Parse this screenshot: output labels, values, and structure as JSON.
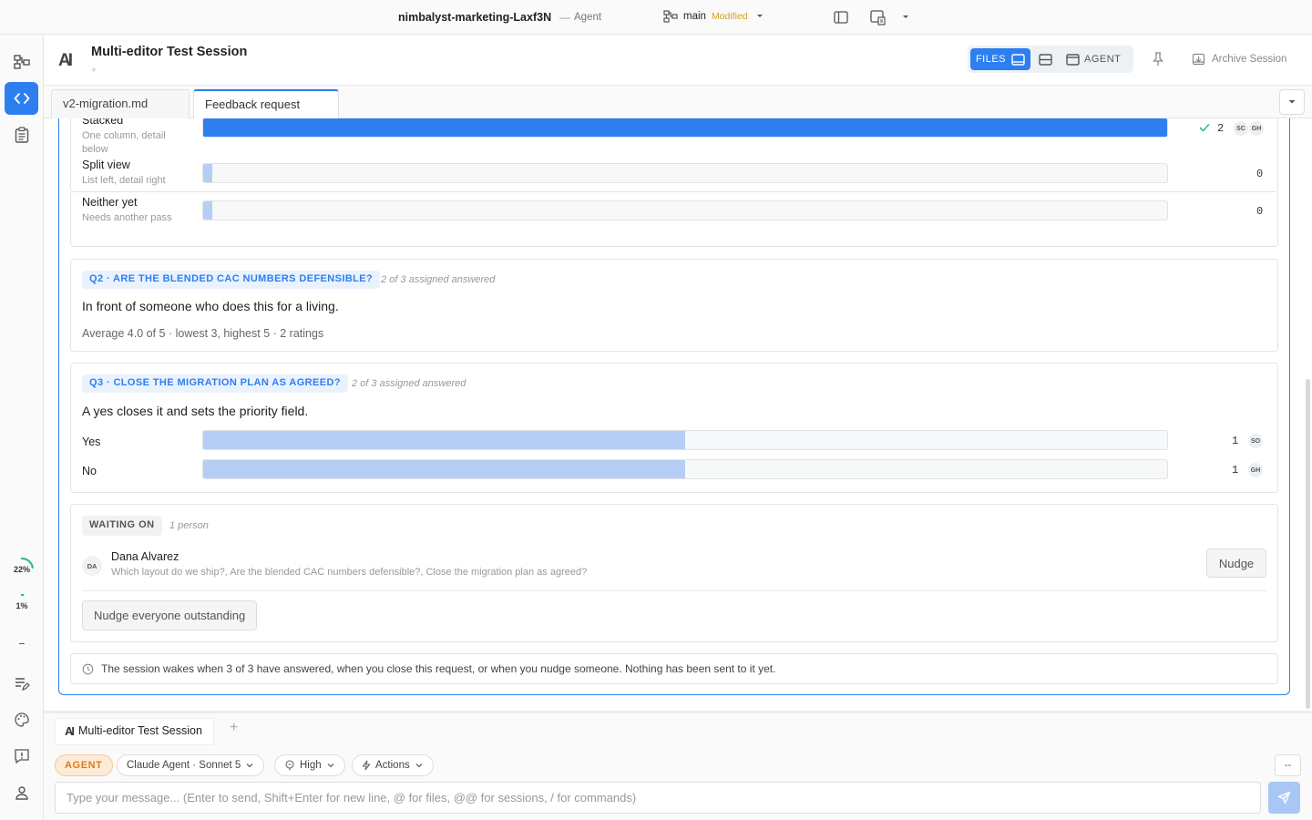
{
  "titlebar": {
    "project": "nimbalyst-marketing-Laxf3N",
    "separator": "—",
    "mode": "Agent",
    "branch": "main",
    "branch_status": "Modified"
  },
  "sidebar": {
    "usage": [
      {
        "label": "22%",
        "value": 0.22
      },
      {
        "label": "1%",
        "value": 0.01
      },
      {
        "label": "--",
        "value": 0
      }
    ]
  },
  "header": {
    "logo": "AI",
    "title": "Multi-editor Test Session",
    "add": "+",
    "files_label": "FILES",
    "agent_label": "AGENT",
    "archive_label": "Archive Session"
  },
  "tabs": [
    {
      "label": "v2-migration.md",
      "active": false
    },
    {
      "label": "Feedback request",
      "active": true
    }
  ],
  "q1": {
    "options": [
      {
        "label": "Stacked",
        "sub": "One column, detail below",
        "fraction": 1.0,
        "count": "2",
        "chips": [
          "SC",
          "GH"
        ]
      },
      {
        "label": "Split view",
        "sub": "List left, detail right",
        "fraction": 0.0,
        "count": "0",
        "chips": []
      },
      {
        "label": "Neither yet",
        "sub": "Needs another pass",
        "fraction": 0.0,
        "count": "0",
        "chips": []
      }
    ]
  },
  "q2": {
    "tag": "Q2 · ARE THE BLENDED CAC NUMBERS DEFENSIBLE?",
    "meta": "2 of 3 assigned answered",
    "text": "In front of someone who does this for a living.",
    "avg": "Average 4.0 of 5 · lowest 3, highest 5 · 2 ratings"
  },
  "q3": {
    "tag": "Q3 · CLOSE THE MIGRATION PLAN AS AGREED?",
    "meta": "2 of 3 assigned answered",
    "text": "A yes closes it and sets the priority field.",
    "options": [
      {
        "label": "Yes",
        "fraction": 0.5,
        "count": "1",
        "chip": "SO"
      },
      {
        "label": "No",
        "fraction": 0.5,
        "count": "1",
        "chip": "GH"
      }
    ]
  },
  "waiting": {
    "tag": "WAITING ON",
    "meta": "1 person",
    "person": {
      "initials": "DA",
      "name": "Dana Alvarez",
      "questions": "Which layout do we ship?, Are the blended CAC numbers defensible?, Close the migration plan as agreed?"
    },
    "nudge_label": "Nudge",
    "nudge_all_label": "Nudge everyone outstanding"
  },
  "wake_note": "The session wakes when 3 of 3 have answered, when you close this request, or when you nudge someone. Nothing has been sent to it yet.",
  "bottom_tab": {
    "label": "Multi-editor Test Session",
    "add": "+"
  },
  "composer": {
    "agent_badge": "AGENT",
    "model": "Claude Agent · Sonnet 5",
    "effort": "High",
    "actions": "Actions",
    "dash": "--",
    "placeholder": "Type your message... (Enter to send, Shift+Enter for new line, @ for files, @@ for sessions, / for commands)"
  },
  "colors": {
    "accent": "#2d7ff0",
    "bar_light": "#b6cef5",
    "modified": "#d4a017",
    "agent_badge": "#d97a20"
  }
}
